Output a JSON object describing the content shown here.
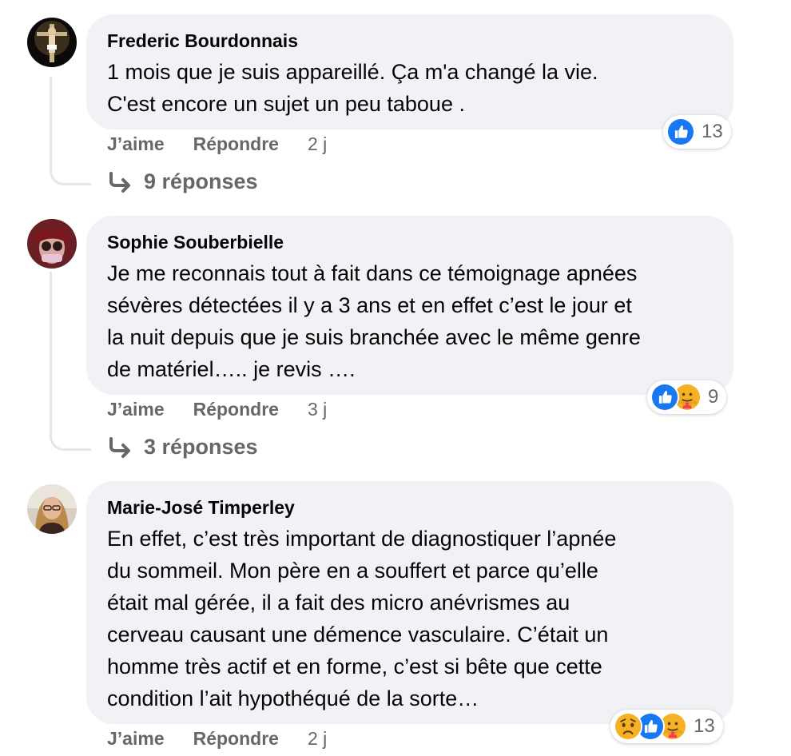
{
  "comments": [
    {
      "author": "Frederic Bourdonnais",
      "text": "1 mois que je suis appareillé. Ça m'a changé la vie.\nC'est encore un sujet un peu taboue .",
      "like_label": "J’aime",
      "reply_label": "Répondre",
      "time": "2 j",
      "reactions": [
        "like"
      ],
      "reaction_count": "13",
      "replies_label": "9 réponses"
    },
    {
      "author": "Sophie Souberbielle",
      "text": "Je me reconnais tout à fait dans ce témoignage apnées\nsévères détectées il y a 3 ans et en effet c’est le jour et\nla nuit depuis que je suis branchée avec le même genre\nde matériel….. je revis ….",
      "like_label": "J’aime",
      "reply_label": "Répondre",
      "time": "3 j",
      "reactions": [
        "like",
        "care"
      ],
      "reaction_count": "9",
      "replies_label": "3 réponses"
    },
    {
      "author": "Marie-José Timperley",
      "text": "En effet, c’est très important de diagnostiquer l’apnée\ndu sommeil. Mon père en a souffert et parce qu’elle\nétait mal gérée, il a fait des micro anévrismes au\ncerveau causant une démence vasculaire. C’était un\nhomme très actif et en forme, c’est si bête que cette\ncondition l’ait hypothéqué de la sorte…",
      "like_label": "J’aime",
      "reply_label": "Répondre",
      "time": "2 j",
      "reactions": [
        "sad",
        "like",
        "care"
      ],
      "reaction_count": "13"
    }
  ],
  "colors": {
    "bubble": "#f0f2f5",
    "meta_text": "#65676b",
    "like_blue": "#1877f2",
    "thread_line": "#e4e6eb"
  }
}
